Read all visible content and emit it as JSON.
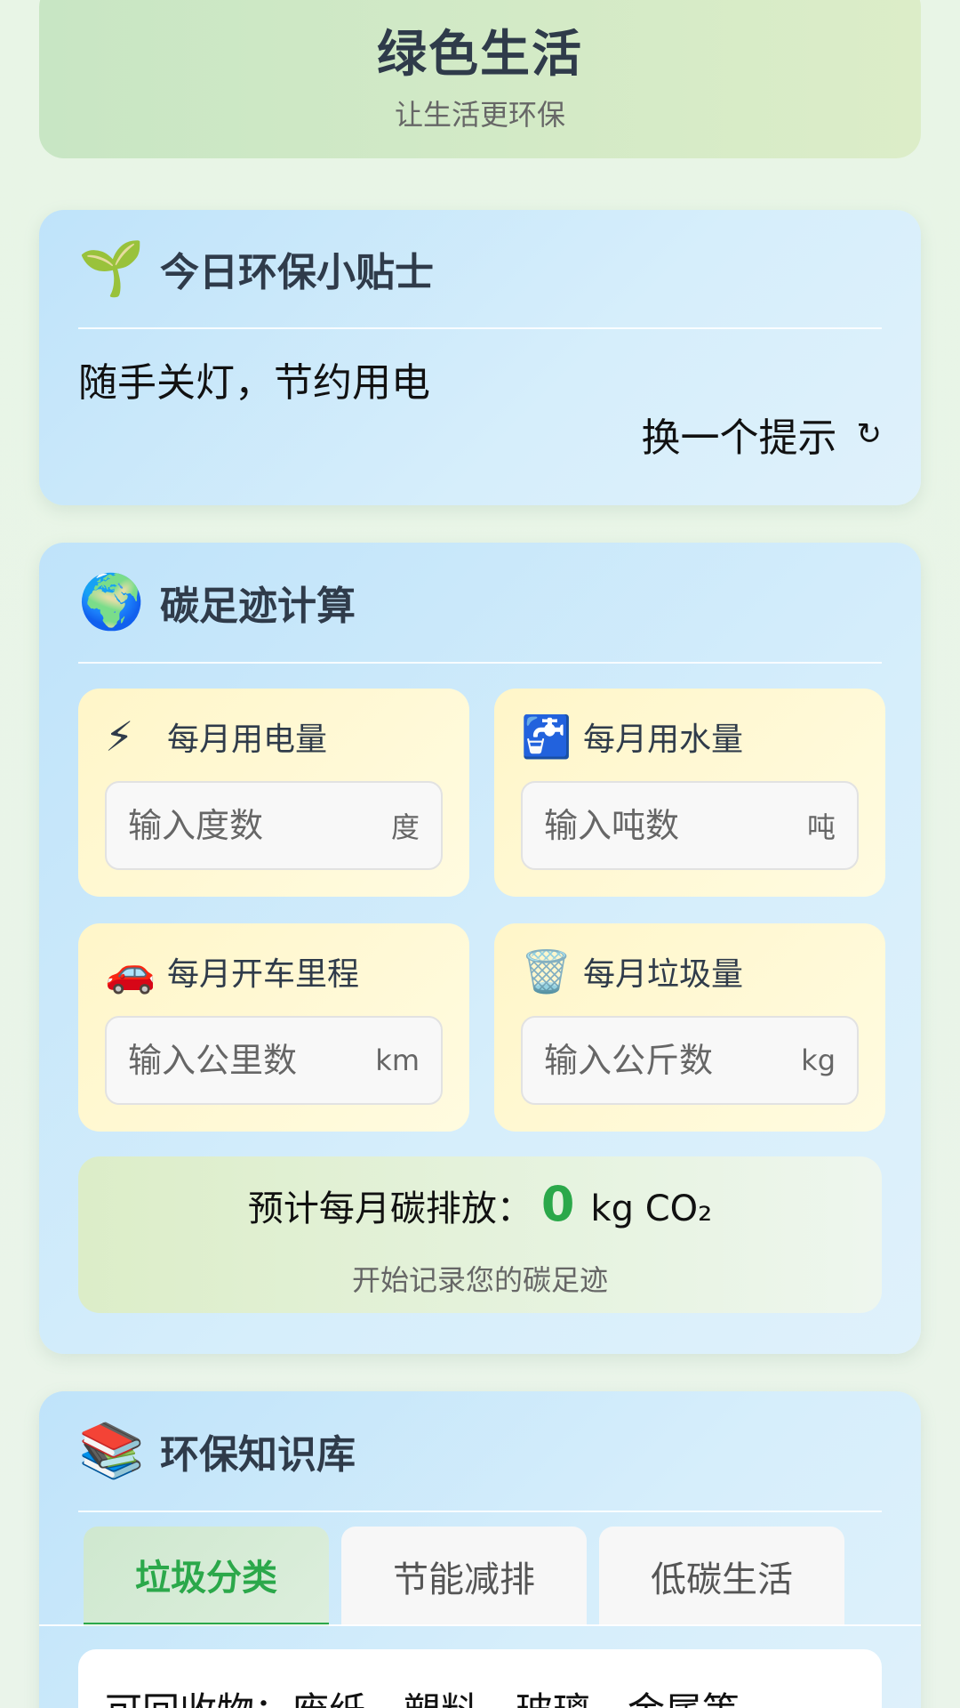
{
  "header": {
    "title": "绿色生活",
    "subtitle": "让生活更环保"
  },
  "tip": {
    "icon": "seedling-icon",
    "icon_glyph": "🌱",
    "title": "今日环保小贴士",
    "text": "随手关灯，节约用电",
    "refresh_label": "换一个提示",
    "refresh_glyph": "↻"
  },
  "carbon": {
    "icon": "globe-icon",
    "icon_glyph": "🌍",
    "title": "碳足迹计算",
    "fields": [
      {
        "icon": "lightning-icon",
        "glyph": "⚡",
        "label": "每月用电量",
        "placeholder": "输入度数",
        "unit": "度",
        "value": ""
      },
      {
        "icon": "water-tap-icon",
        "glyph": "🚰",
        "label": "每月用水量",
        "placeholder": "输入吨数",
        "unit": "吨",
        "value": ""
      },
      {
        "icon": "car-icon",
        "glyph": "🚗",
        "label": "每月开车里程",
        "placeholder": "输入公里数",
        "unit": "km",
        "value": ""
      },
      {
        "icon": "trash-icon",
        "glyph": "🗑️",
        "label": "每月垃圾量",
        "placeholder": "输入公斤数",
        "unit": "kg",
        "value": ""
      }
    ],
    "result": {
      "label": "预计每月碳排放：",
      "value": "0",
      "unit": "kg CO₂",
      "hint": "开始记录您的碳足迹"
    },
    "accent_color": "#2ba84a"
  },
  "knowledge": {
    "icon": "books-icon",
    "icon_glyph": "📚",
    "title": "环保知识库",
    "tabs": [
      {
        "label": "垃圾分类",
        "active": true
      },
      {
        "label": "节能减排",
        "active": false
      },
      {
        "label": "低碳生活",
        "active": false
      }
    ],
    "content": "可回收物：废纸、塑料、玻璃、金属等"
  }
}
